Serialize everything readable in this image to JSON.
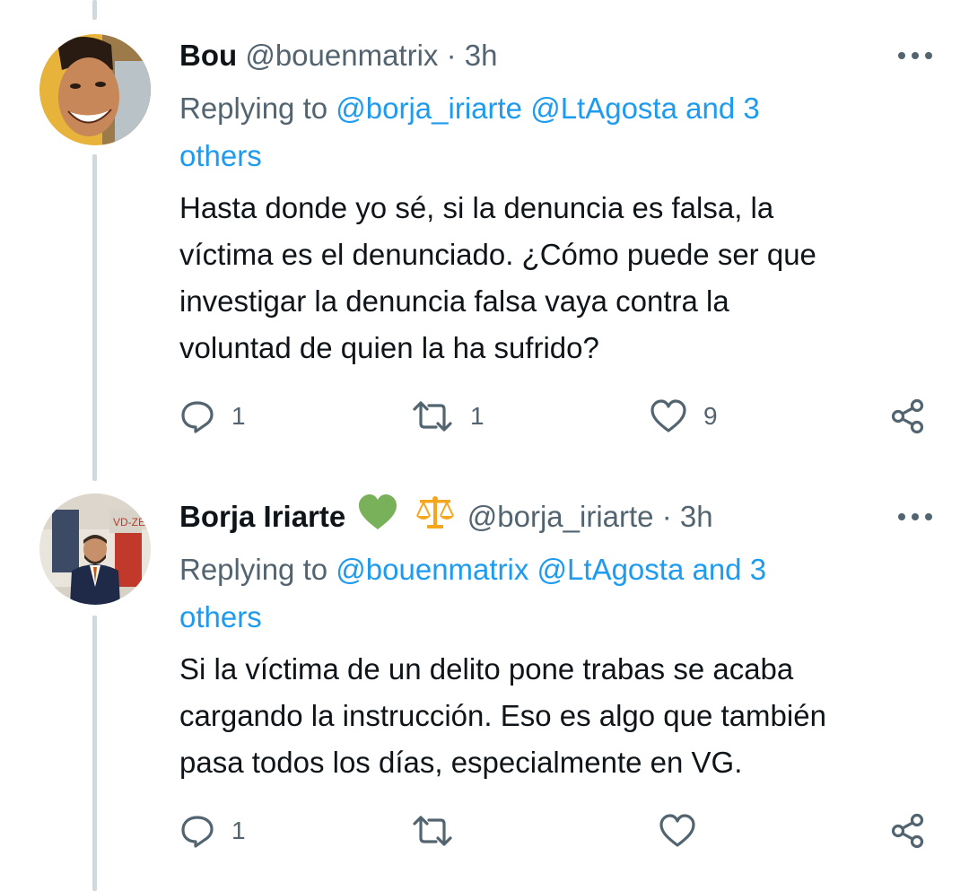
{
  "tweets": [
    {
      "display_name": "Bou",
      "handle": "@bouenmatrix",
      "separator": "·",
      "time": "3h",
      "replying_prefix": "Replying to",
      "replying_mentions": "@borja_iriarte @LtAgosta and 3",
      "replying_others": "others",
      "text": "Hasta donde yo sé, si la denuncia es falsa, la\nvíctima es el denunciado. ¿Cómo puede ser que\ninvestigar la denuncia falsa vaya contra la\nvoluntad de quien la ha sufrido?",
      "reply_count": "1",
      "retweet_count": "1",
      "like_count": "9",
      "avatar_icon": "avatar-smiling-man"
    },
    {
      "display_name": "Borja Iriarte",
      "badges": [
        "green-heart-icon",
        "scales-icon"
      ],
      "handle": "@borja_iriarte",
      "separator": "·",
      "time": "3h",
      "replying_prefix": "Replying to",
      "replying_mentions": "@bouenmatrix @LtAgosta and 3",
      "replying_others": "others",
      "text": "Si la víctima de un delito pone trabas se acaba\ncargando la instrucción. Eso es algo que también\npasa todos los días, especialmente en VG.",
      "reply_count": "1",
      "retweet_count": "",
      "like_count": "",
      "avatar_icon": "avatar-man-in-suit"
    }
  ],
  "colors": {
    "text": "#0f1419",
    "secondary": "#536471",
    "link": "#1d9bf0",
    "thread_line": "#cfd9de",
    "heart_emoji": "#78b159",
    "scales_emoji": "#f4a71d"
  }
}
